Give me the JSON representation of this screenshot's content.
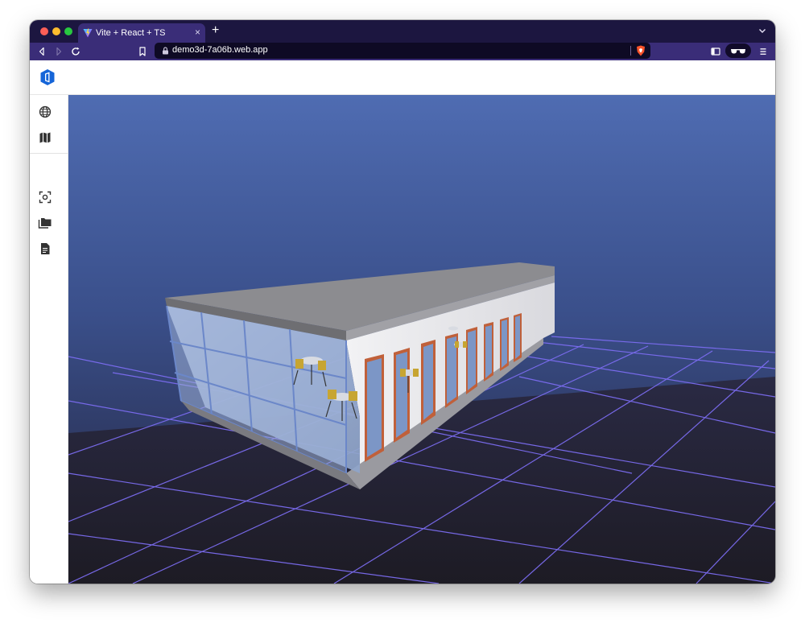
{
  "browser": {
    "tab": {
      "title": "Vite + React + TS",
      "close": "×",
      "favicon": "vite-icon"
    },
    "new_tab": "+",
    "url": "demo3d-7a06b.web.app",
    "icons": [
      "back-icon",
      "forward-icon",
      "reload-icon",
      "bookmark-icon",
      "lock-icon",
      "brave-shield-icon",
      "sidebar-toggle-icon",
      "private-glasses-icon",
      "menu-icon",
      "tabs-chevron-icon"
    ]
  },
  "app": {
    "logo": "app-logo-icon",
    "sidebar": {
      "top_items": [
        {
          "icon": "globe-icon"
        },
        {
          "icon": "map-icon"
        }
      ],
      "bottom_items": [
        {
          "icon": "focus-frame-icon"
        },
        {
          "icon": "folders-icon"
        },
        {
          "icon": "document-icon"
        }
      ]
    },
    "scene": {
      "description_colors": {
        "sky_top": "#4f6cb2",
        "sky_bottom": "#22223a",
        "floor": "#1e1c26",
        "grid": "#7b6cf0",
        "roof": "#8a8a8a",
        "wall": "#e9e9ec",
        "glass": "#a3b6d8",
        "window_frame": "#c0603a",
        "chair": "#c7a532"
      }
    }
  }
}
